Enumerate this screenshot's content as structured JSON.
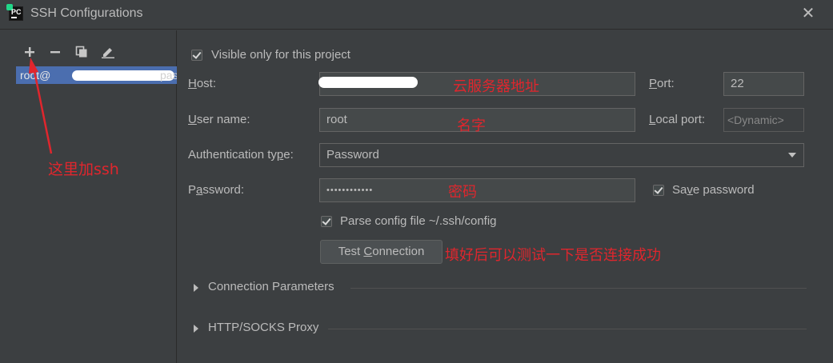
{
  "window": {
    "title": "SSH Configurations",
    "close_glyph": "✕",
    "app_icon_text": "PC"
  },
  "toolbar": {
    "add_icon": "plus-icon",
    "remove_icon": "minus-icon",
    "copy_icon": "copy-icon",
    "edit_icon": "edit-icon"
  },
  "hosts": [
    {
      "prefix": "root@",
      "suffix": "pas"
    }
  ],
  "form": {
    "visible_only": "Visible only for this project",
    "host_label": "Host:",
    "port_label": "Port:",
    "port_value": "22",
    "username_label": "User name:",
    "username_value": "root",
    "local_port_label": "Local port:",
    "local_port_placeholder": "<Dynamic>",
    "auth_label": "Authentication type:",
    "auth_value": "Password",
    "password_label": "Password:",
    "password_value": "••••••••••••",
    "save_password": "Save password",
    "parse_config": "Parse config file ~/.ssh/config",
    "test_connection": "Test Connection"
  },
  "sections": [
    "Connection Parameters",
    "HTTP/SOCKS Proxy"
  ],
  "annotations": {
    "add_ssh": "这里加ssh",
    "host_note": "云服务器地址",
    "username_note": "名字",
    "password_note": "密码",
    "test_note": "填好后可以测试一下是否连接成功"
  },
  "colors": {
    "annotation": "#e0262d",
    "selection": "#4b6eaf",
    "background": "#3c3f41"
  }
}
